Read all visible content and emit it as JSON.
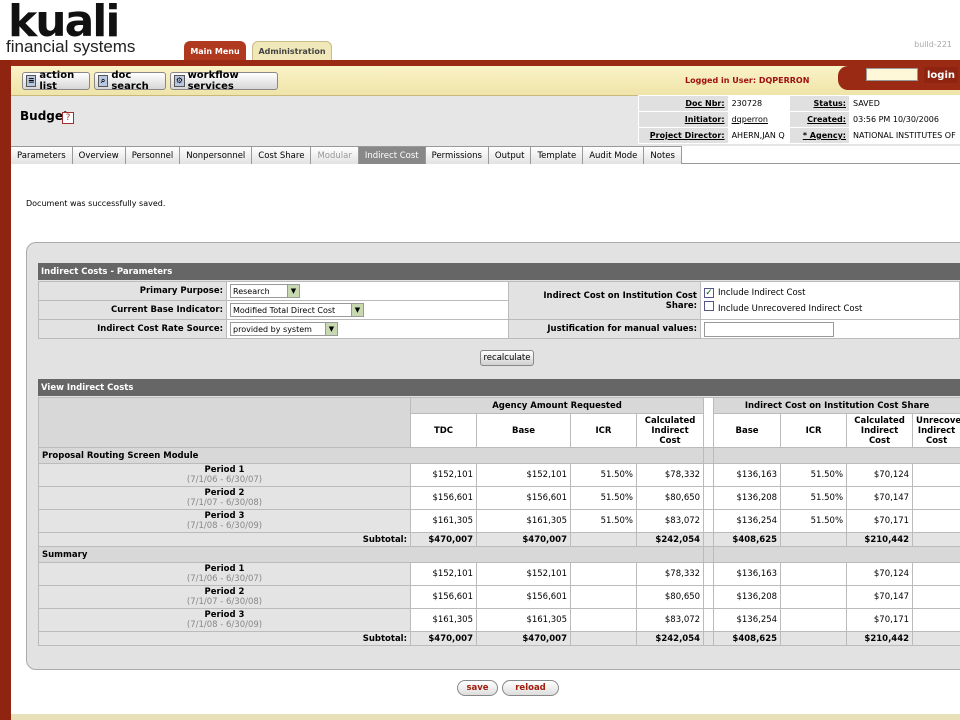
{
  "header": {
    "logo_text": "kuali",
    "logo_sub": "financial systems",
    "build": "build-221",
    "tabs": [
      "Main Menu",
      "Administration"
    ]
  },
  "toolbar": {
    "action_list": "action list",
    "doc_search": "doc search",
    "workflow": "workflow services",
    "logged_in": "Logged in User: DQPERRON",
    "login": "login"
  },
  "doc": {
    "title": "Budget",
    "help": "?",
    "info": [
      {
        "l1": "Doc Nbr:",
        "v1": "230728",
        "l2": "Status:",
        "v2": "SAVED"
      },
      {
        "l1": "Initiator:",
        "v1": "dqperron",
        "l2": "Created:",
        "v2": "03:56 PM 10/30/2006"
      },
      {
        "l1": "Project Director:",
        "v1": "AHERN,JAN Q",
        "l2": "* Agency:",
        "v2": "NATIONAL INSTITUTES OF"
      }
    ]
  },
  "nav": {
    "tabs": [
      "Parameters",
      "Overview",
      "Personnel",
      "Nonpersonnel",
      "Cost Share",
      "Modular",
      "Indirect Cost",
      "Permissions",
      "Output",
      "Template",
      "Audit Mode",
      "Notes"
    ],
    "disabled": "Modular",
    "selected": "Indirect Cost"
  },
  "message": "Document was successfully saved.",
  "params": {
    "title": "Indirect Costs - Parameters",
    "primary_purpose_label": "Primary Purpose:",
    "primary_purpose": "Research",
    "base_indicator_label": "Current Base Indicator:",
    "base_indicator": "Modified Total Direct Cost",
    "rate_source_label": "Indirect Cost Rate Source:",
    "rate_source": "provided by system",
    "institution_label": "Indirect Cost on Institution Cost Share:",
    "include_ic": "Include Indirect Cost",
    "include_unrecovered": "Include Unrecovered Indirect Cost",
    "justification_label": "Justification for manual values:",
    "recalculate": "recalculate"
  },
  "view": {
    "title": "View Indirect Costs",
    "group_agency": "Agency Amount Requested",
    "group_inst": "Indirect Cost on Institution Cost Share",
    "cols": [
      "TDC",
      "Base",
      "ICR",
      "Calculated Indirect Cost",
      "Base",
      "ICR",
      "Calculated Indirect Cost",
      "Unrecovered Indirect Cost"
    ],
    "sections": [
      {
        "name": "Proposal Routing Screen Module",
        "rows": [
          {
            "period": "Period 1",
            "dates": "(7/1/06 - 6/30/07)",
            "tdc": "$152,101",
            "base": "$152,101",
            "icr": "51.50%",
            "calc": "$78,332",
            "ibase": "$136,163",
            "iicr": "51.50%",
            "icalc": "$70,124"
          },
          {
            "period": "Period 2",
            "dates": "(7/1/07 - 6/30/08)",
            "tdc": "$156,601",
            "base": "$156,601",
            "icr": "51.50%",
            "calc": "$80,650",
            "ibase": "$136,208",
            "iicr": "51.50%",
            "icalc": "$70,147"
          },
          {
            "period": "Period 3",
            "dates": "(7/1/08 - 6/30/09)",
            "tdc": "$161,305",
            "base": "$161,305",
            "icr": "51.50%",
            "calc": "$83,072",
            "ibase": "$136,254",
            "iicr": "51.50%",
            "icalc": "$70,171"
          }
        ],
        "subtotal": {
          "label": "Subtotal:",
          "tdc": "$470,007",
          "base": "$470,007",
          "calc": "$242,054",
          "ibase": "$408,625",
          "icalc": "$210,442"
        }
      },
      {
        "name": "Summary",
        "rows": [
          {
            "period": "Period 1",
            "dates": "(7/1/06 - 6/30/07)",
            "tdc": "$152,101",
            "base": "$152,101",
            "icr": "",
            "calc": "$78,332",
            "ibase": "$136,163",
            "iicr": "",
            "icalc": "$70,124"
          },
          {
            "period": "Period 2",
            "dates": "(7/1/07 - 6/30/08)",
            "tdc": "$156,601",
            "base": "$156,601",
            "icr": "",
            "calc": "$80,650",
            "ibase": "$136,208",
            "iicr": "",
            "icalc": "$70,147"
          },
          {
            "period": "Period 3",
            "dates": "(7/1/08 - 6/30/09)",
            "tdc": "$161,305",
            "base": "$161,305",
            "icr": "",
            "calc": "$83,072",
            "ibase": "$136,254",
            "iicr": "",
            "icalc": "$70,171"
          }
        ],
        "subtotal": {
          "label": "Subtotal:",
          "tdc": "$470,007",
          "base": "$470,007",
          "calc": "$242,054",
          "ibase": "$408,625",
          "icalc": "$210,442"
        }
      }
    ]
  },
  "buttons": {
    "save": "save",
    "reload": "reload"
  }
}
